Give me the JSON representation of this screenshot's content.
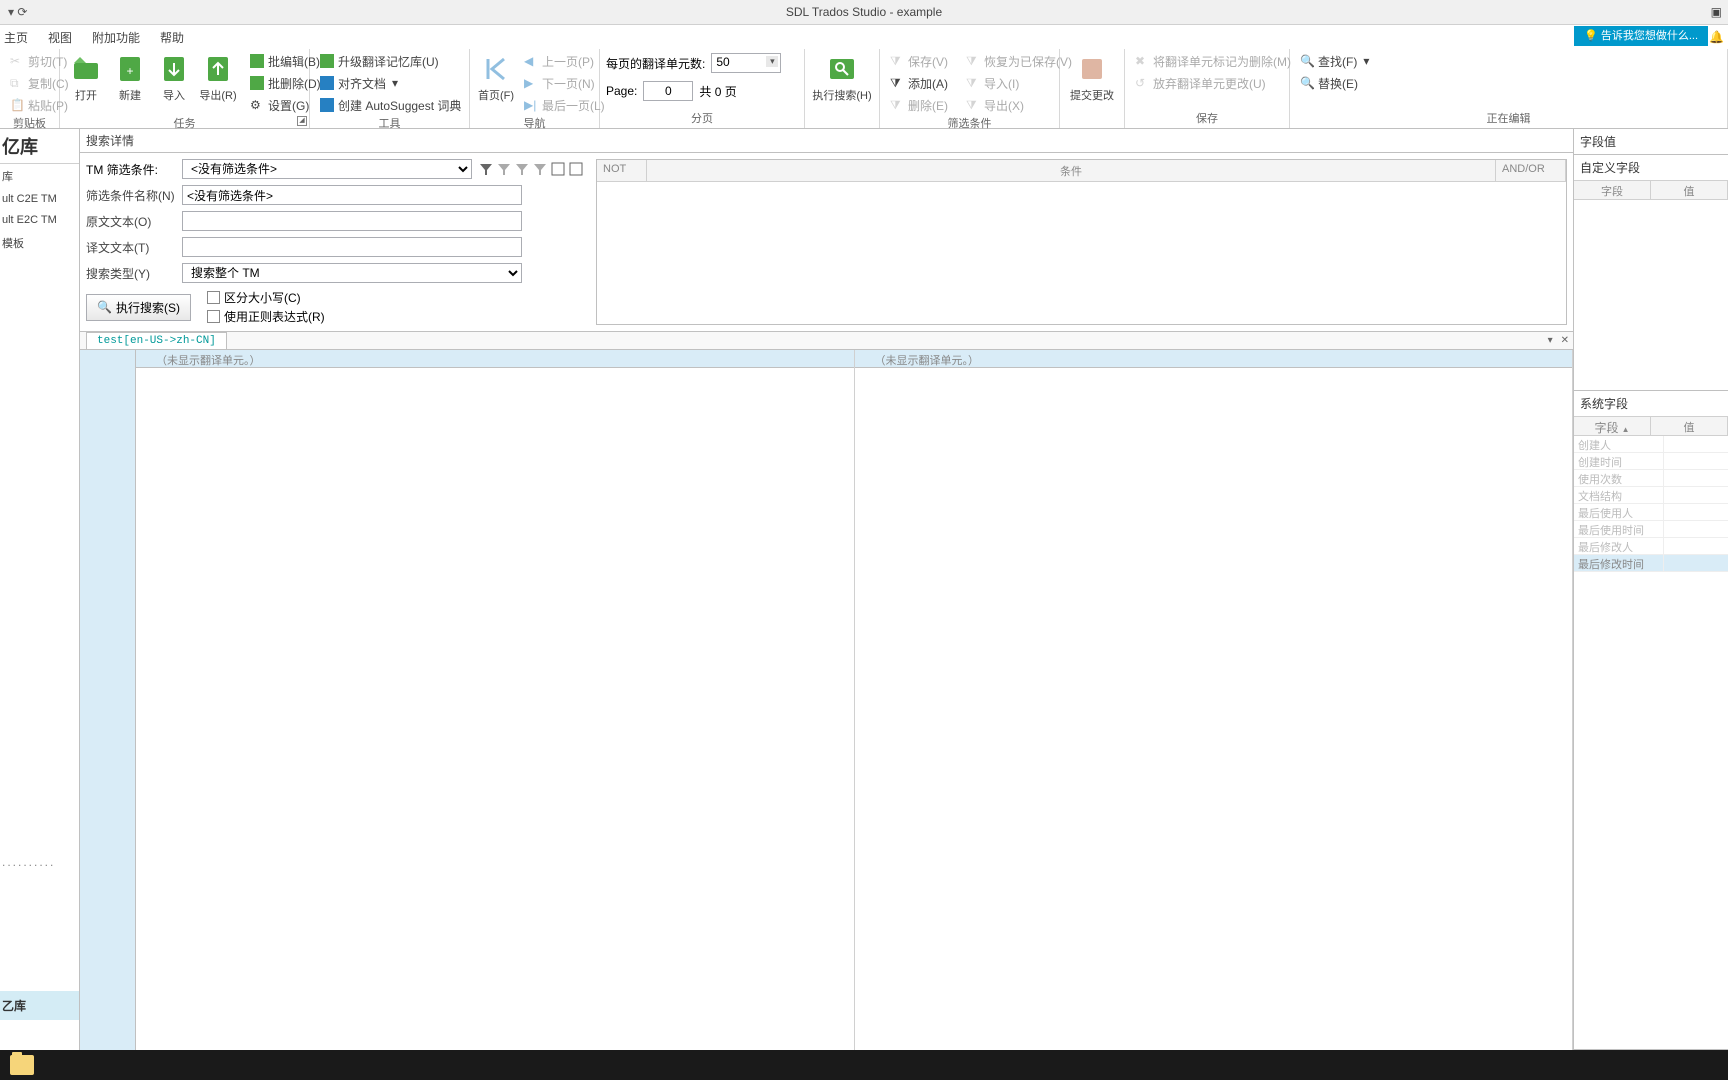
{
  "title": "SDL Trados Studio - example",
  "menu": {
    "home": "主页",
    "view": "视图",
    "addins": "附加功能",
    "help": "帮助"
  },
  "tell_me": "告诉我您想做什么...",
  "ribbon": {
    "clipboard": {
      "label": "剪贴板",
      "cut": "剪切(T)",
      "copy": "复制(C)",
      "paste": "粘贴(P)"
    },
    "tasks": {
      "label": "任务",
      "open": "打开",
      "new": "新建",
      "import": "导入",
      "export": "导出(R)",
      "batch_edit": "批编辑(B)",
      "batch_delete": "批删除(D)",
      "settings": "设置(G)"
    },
    "tools": {
      "label": "工具",
      "upgrade": "升级翻译记忆库(U)",
      "align": "对齐文档",
      "autosuggest": "创建 AutoSuggest 词典"
    },
    "nav": {
      "label": "导航",
      "first": "首页(F)",
      "prev": "上一页(P)",
      "next": "下一页(N)",
      "last": "最后一页(L)"
    },
    "paging": {
      "label": "分页",
      "units_label": "每页的翻译单元数:",
      "units_value": "50",
      "page_label": "Page:",
      "page_value": "0",
      "total": "共 0 页"
    },
    "search": {
      "label": "",
      "execute": "执行搜索(H)"
    },
    "filter": {
      "label": "筛选条件",
      "save": "保存(V)",
      "restore": "恢复为已保存(V)",
      "add": "添加(A)",
      "import": "导入(I)",
      "delete": "删除(E)",
      "export": "导出(X)"
    },
    "commit": {
      "label": "",
      "btn": "提交更改"
    },
    "save": {
      "label": "保存",
      "mark_delete": "将翻译单元标记为删除(M)",
      "discard": "放弃翻译单元更改(U)"
    },
    "editing": {
      "label": "正在编辑",
      "find": "查找(F)",
      "replace": "替换(E)"
    }
  },
  "left": {
    "title": "亿库",
    "item_lib": "库",
    "tm1": "ult C2E TM",
    "tm2": "ult E2C TM",
    "templates": "模板",
    "footer": "乙库"
  },
  "search_details": {
    "header": "搜索详情",
    "tm_filter_label": "TM 筛选条件:",
    "tm_filter_value": "<没有筛选条件>",
    "filter_name_label": "筛选条件名称(N)",
    "filter_name_value": "<没有筛选条件>",
    "source_label": "原文文本(O)",
    "target_label": "译文文本(T)",
    "type_label": "搜索类型(Y)",
    "type_value": "搜索整个 TM",
    "exec": "执行搜索(S)",
    "case": "区分大小写(C)",
    "regex": "使用正则表达式(R)",
    "cond_not": "NOT",
    "cond_cond": "条件",
    "cond_andor": "AND/OR"
  },
  "tab": "test[en-US->zh-CN]",
  "grid_empty": "（未显示翻译单元。）",
  "right": {
    "field_values": "字段值",
    "custom_fields": "自定义字段",
    "col_field": "字段",
    "col_value": "值",
    "system_fields": "系统字段",
    "rows": [
      "创建人",
      "创建时间",
      "使用次数",
      "文档结构",
      "最后使用人",
      "最后使用时间",
      "最后修改人",
      "最后修改时间"
    ]
  }
}
